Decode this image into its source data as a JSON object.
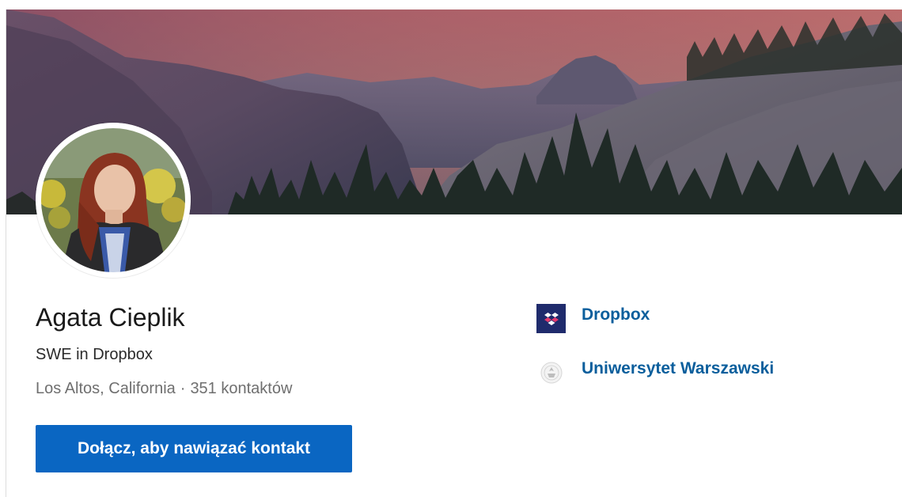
{
  "profile": {
    "name": "Agata Cieplik",
    "headline": "SWE in Dropbox",
    "location": "Los Altos, California",
    "separator": "·",
    "connections": "351 kontaktów",
    "connect_button": "Dołącz, aby nawiązać kontakt"
  },
  "organizations": [
    {
      "name": "Dropbox",
      "icon": "dropbox-logo-icon"
    },
    {
      "name": "Uniwersytet Warszawski",
      "icon": "university-logo-icon"
    }
  ],
  "colors": {
    "accent": "#0a66c2",
    "link": "#0a5e9c",
    "dropbox_logo_bg": "#1f2b6c"
  }
}
